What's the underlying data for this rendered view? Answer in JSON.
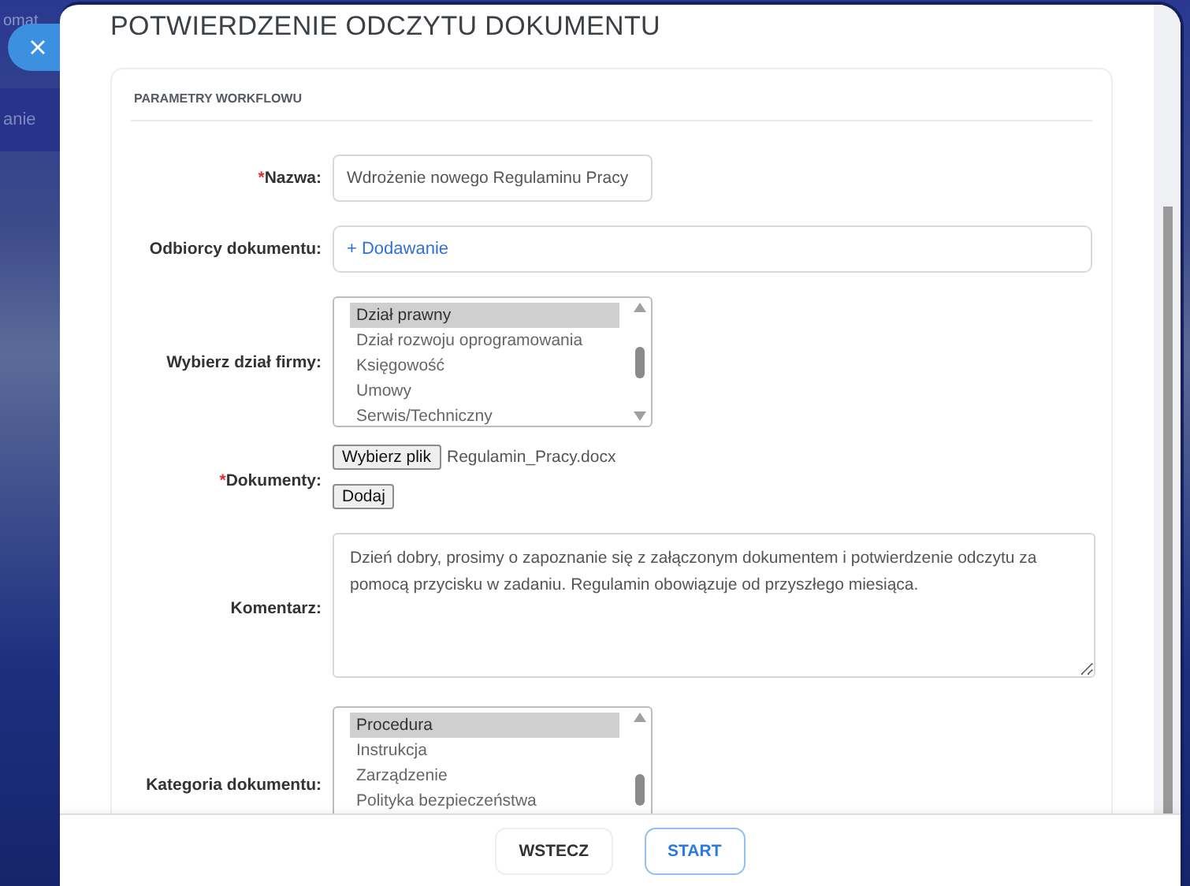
{
  "background": {
    "menu_texts": [
      "omat",
      "anie"
    ]
  },
  "dialog": {
    "title": "POTWIERDZENIE ODCZYTU DOKUMENTU",
    "section": {
      "title": "PARAMETRY WORKFLOWU",
      "fields": [
        {
          "kind": "text",
          "label": "Nazwa:",
          "required_mark": "*",
          "value": "Wdrożenie nowego Regulaminu Pracy"
        },
        {
          "kind": "recipients",
          "label": "Odbiorcy dokumentu:",
          "link": "+ Dodawanie"
        },
        {
          "kind": "listbox",
          "label": "Wybierz dział firmy:",
          "options": [
            {
              "label": "Dział prawny",
              "selected": true
            },
            {
              "label": "Dział rozwoju oprogramowania",
              "selected": false
            },
            {
              "label": "Księgowość",
              "selected": false
            },
            {
              "label": "Umowy",
              "selected": false
            },
            {
              "label": "Serwis/Techniczny",
              "selected": false
            }
          ]
        },
        {
          "kind": "file",
          "label": "Dokumenty:",
          "required_mark": "*",
          "choose_button": "Wybierz plik",
          "file_name": "Regulamin_Pracy.docx",
          "add_button": "Dodaj"
        },
        {
          "kind": "textarea",
          "label": "Komentarz:",
          "value": "Dzień dobry, prosimy o zapoznanie się z załączonym dokumentem i potwierdzenie odczytu za pomocą przycisku w zadaniu. Regulamin obowiązuje od przyszłego miesiąca."
        },
        {
          "kind": "listbox",
          "label": "Kategoria dokumentu:",
          "options": [
            {
              "label": "Procedura",
              "selected": true
            },
            {
              "label": "Instrukcja",
              "selected": false
            },
            {
              "label": "Zarządzenie",
              "selected": false
            },
            {
              "label": "Polityka bezpieczeństwa",
              "selected": false
            }
          ]
        }
      ]
    },
    "buttons": [
      {
        "label": "WSTECZ",
        "primary": false
      },
      {
        "label": "START",
        "primary": true
      }
    ]
  }
}
